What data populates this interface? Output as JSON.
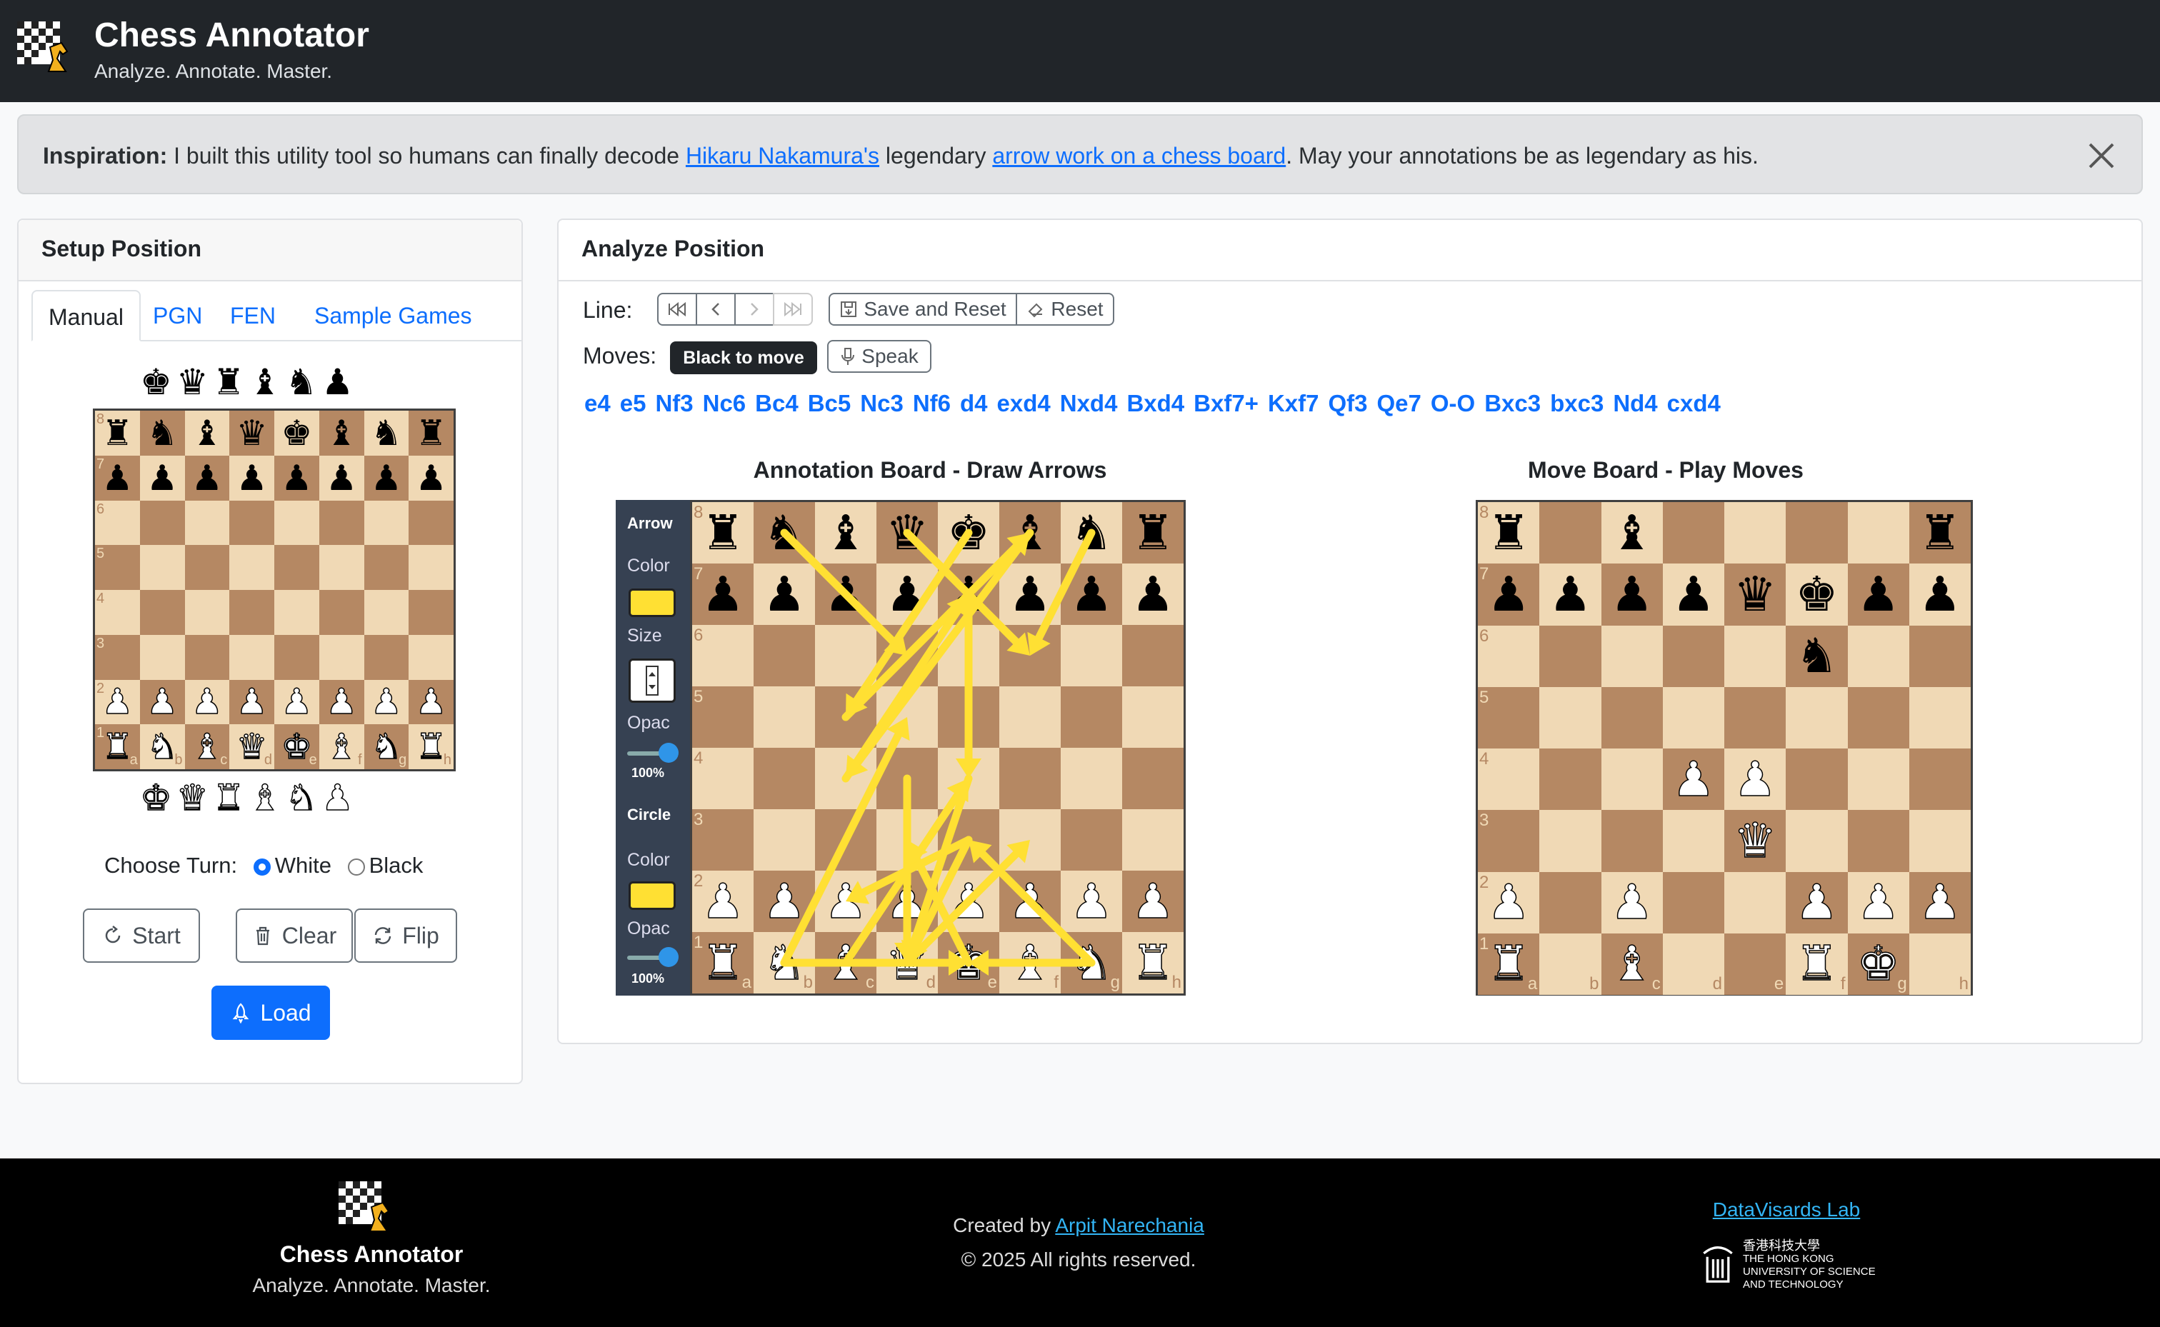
{
  "header": {
    "title": "Chess Annotator",
    "tagline": "Analyze. Annotate. Master."
  },
  "alert": {
    "label": "Inspiration:",
    "text1": "I built this utility tool so humans can finally decode",
    "link1": "Hikaru Nakamura's",
    "text2": "legendary",
    "link2": "arrow work on a chess board",
    "text3": ". May your annotations be as legendary as his."
  },
  "setup": {
    "title": "Setup Position",
    "tabs": [
      "Manual",
      "PGN",
      "FEN",
      "Sample Games"
    ],
    "choose_turn_label": "Choose Turn:",
    "turn_options": [
      "White",
      "Black"
    ],
    "selected_turn": "White",
    "buttons": {
      "start": "Start",
      "clear": "Clear",
      "flip": "Flip",
      "load": "Load"
    },
    "spare_black": "kqrbnp",
    "spare_white": "KQRBNP",
    "position": [
      "rnbqkbnr",
      "pppppppp",
      "........",
      "........",
      "........",
      "........",
      "PPPPPPPP",
      "RNBQKBNR"
    ]
  },
  "analyze": {
    "title": "Analyze Position",
    "line_label": "Line:",
    "moves_label": "Moves:",
    "save_reset": "Save and Reset",
    "reset": "Reset",
    "turn_badge": "Black to move",
    "speak": "Speak",
    "moves": [
      "e4",
      "e5",
      "Nf3",
      "Nc6",
      "Bc4",
      "Bc5",
      "Nc3",
      "Nf6",
      "d4",
      "exd4",
      "Nxd4",
      "Bxd4",
      "Bxf7+",
      "Kxf7",
      "Qf3",
      "Qe7",
      "O-O",
      "Bxc3",
      "bxc3",
      "Nd4",
      "cxd4"
    ],
    "annotation_title": "Annotation Board - Draw Arrows",
    "move_title": "Move Board - Play Moves",
    "annotation_position": [
      "rnbqkbnr",
      "pppppppp",
      "........",
      "........",
      "........",
      "........",
      "PPPPPPPP",
      "RNBQKBNR"
    ],
    "move_position": [
      "r.b....r",
      "ppppqkpp",
      ".....n..",
      "........",
      "...PP...",
      "....Q...",
      "P.P..PPP",
      "R.B..RK."
    ],
    "arrow_color": "#ffe033",
    "toolbar": {
      "arrow": "Arrow",
      "color": "Color",
      "size": "Size",
      "opac": "Opac",
      "opac_value": "100%",
      "circle": "Circle",
      "circle_color": "Color",
      "circle_opac": "Opac",
      "circle_opac_value": "100%"
    },
    "arrows": [
      [
        "b1",
        "d5"
      ],
      [
        "b8",
        "d6"
      ],
      [
        "c1",
        "e4"
      ],
      [
        "d1",
        "f3"
      ],
      [
        "d8",
        "f6"
      ],
      [
        "e8",
        "c5"
      ],
      [
        "f8",
        "c4"
      ],
      [
        "g8",
        "f6"
      ],
      [
        "c5",
        "f8"
      ],
      [
        "g1",
        "e3"
      ],
      [
        "e3",
        "d1"
      ],
      [
        "g1",
        "e1"
      ],
      [
        "d4",
        "d1"
      ],
      [
        "e1",
        "d3"
      ],
      [
        "e3",
        "c2"
      ],
      [
        "b1",
        "e1"
      ],
      [
        "e4",
        "d1"
      ],
      [
        "c4",
        "e7"
      ],
      [
        "e7",
        "e4"
      ]
    ]
  },
  "footer": {
    "title": "Chess Annotator",
    "tagline": "Analyze. Annotate. Master.",
    "created_by": "Created by",
    "author": "Arpit Narechania",
    "rights": "© 2025 All rights reserved.",
    "lab": "DataVisards Lab",
    "uni_cn": "香港科技大學",
    "uni_en1": "THE HONG KONG",
    "uni_en2": "UNIVERSITY OF SCIENCE",
    "uni_en3": "AND TECHNOLOGY"
  }
}
